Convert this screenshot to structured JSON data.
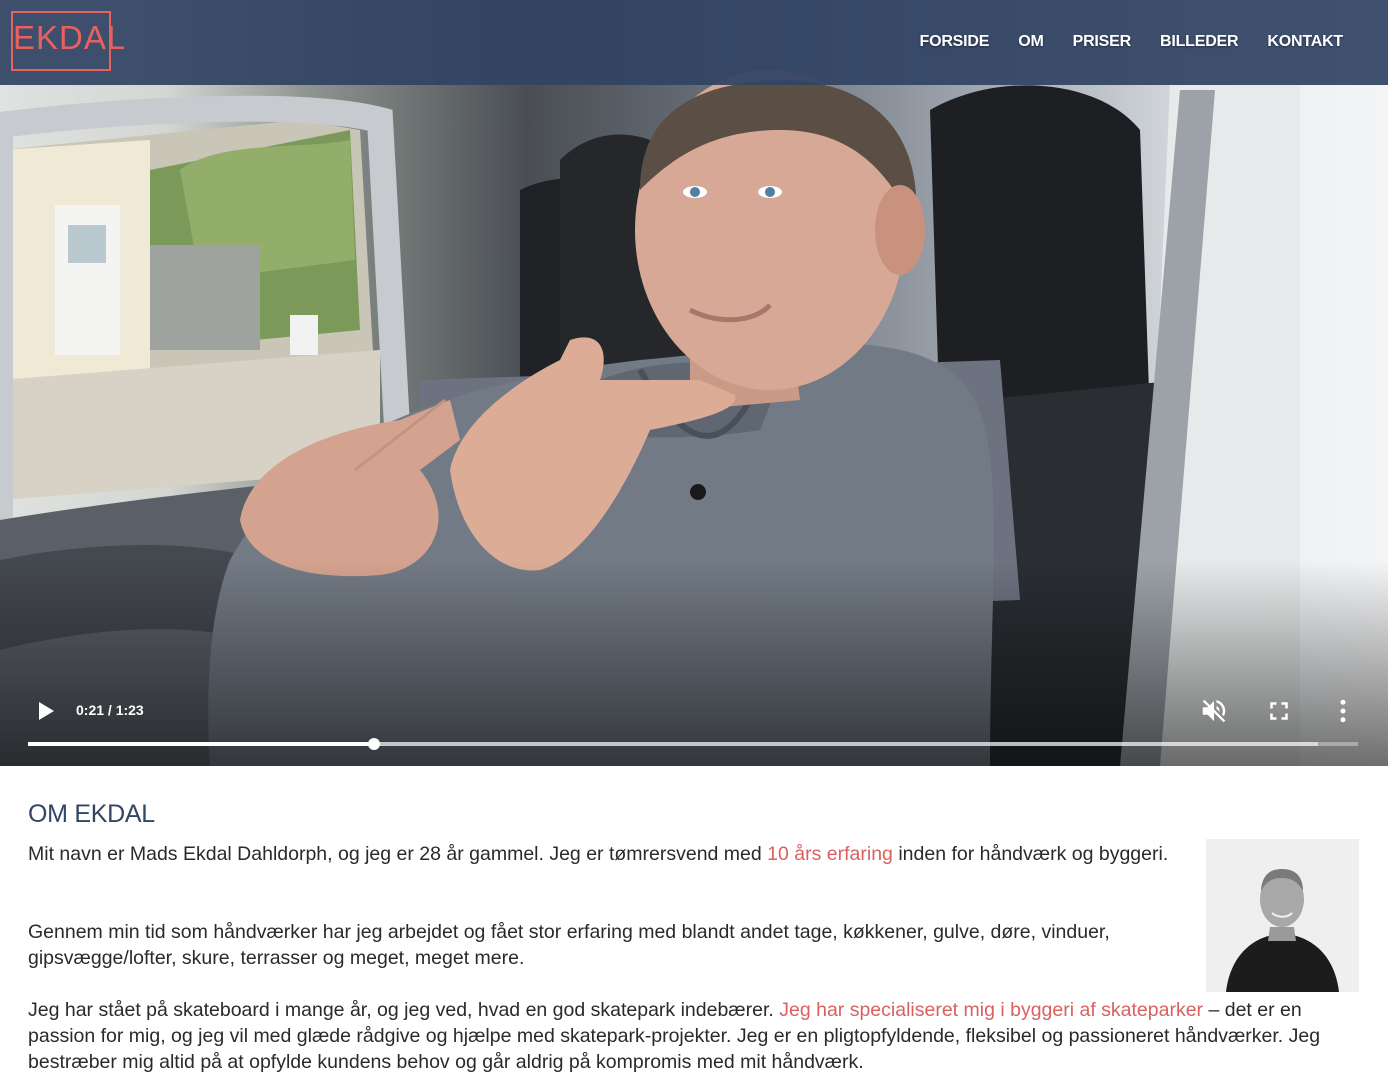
{
  "brand": {
    "logo_text": "EKDAL",
    "accent_color": "#e8605f",
    "header_color": "#324564"
  },
  "nav": {
    "items": [
      {
        "label": "FORSIDE"
      },
      {
        "label": "OM"
      },
      {
        "label": "PRISER"
      },
      {
        "label": "BILLEDER"
      },
      {
        "label": "KONTAKT"
      }
    ]
  },
  "video": {
    "current_time": "0:21",
    "duration": "1:23",
    "time_display": "0:21 / 1:23",
    "progress_fraction": 0.26,
    "buffered_fraction": 0.97,
    "muted": true,
    "icons": [
      "play-icon",
      "volume-muted-icon",
      "fullscreen-icon",
      "more-vertical-icon"
    ]
  },
  "about": {
    "heading": "OM EKDAL",
    "p1_before": "Mit navn er Mads Ekdal Dahldorph, og jeg er 28 år gammel. Jeg er tømrersvend med ",
    "p1_highlight": "10 års erfaring",
    "p1_after": " inden for håndværk og byggeri.",
    "p2": "Gennem min tid som håndværker har jeg arbejdet og fået stor erfaring med blandt andet tage, køkkener, gulve, døre, vinduer, gipsvægge/lofter, skure, terrasser og meget, meget mere.",
    "p3_before": "Jeg har stået på skateboard i mange år, og jeg ved, hvad en god skatepark indebærer. ",
    "p3_highlight": "Jeg har specialiseret mig i byggeri af skateparker",
    "p3_after": " – det er en passion for mig, og jeg vil med glæde rådgive og hjælpe med skatepark-projekter. Jeg er en pligtopfyldende, fleksibel og passioneret håndværker. Jeg bestræber mig altid på at opfylde kundens behov og går aldrig på kompromis med mit håndværk."
  }
}
